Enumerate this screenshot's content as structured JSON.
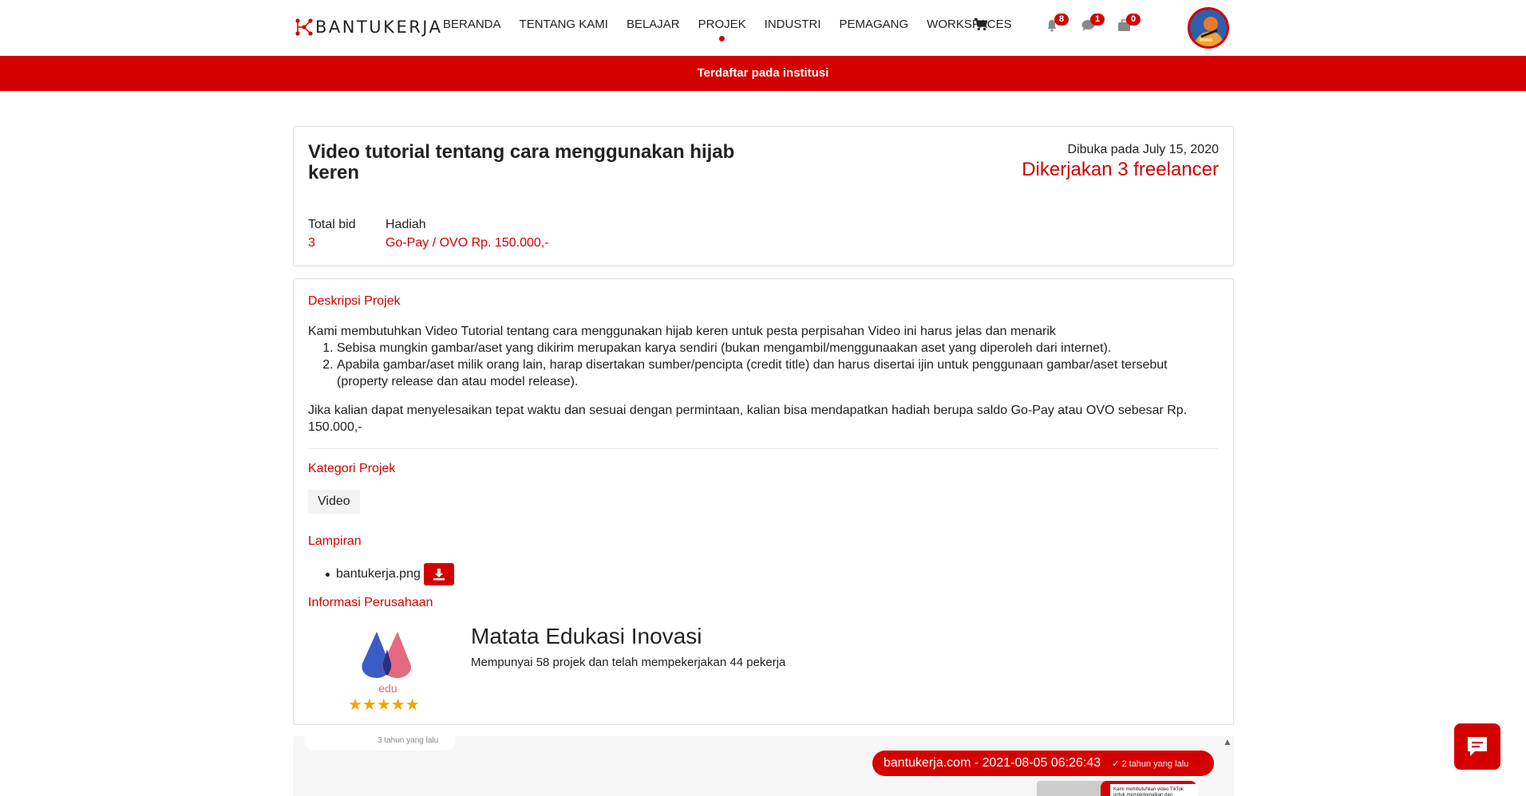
{
  "brand": {
    "name": "BANTUKERJA"
  },
  "nav": {
    "items": [
      {
        "label": "BERANDA",
        "active": false
      },
      {
        "label": "TENTANG KAMI",
        "active": false
      },
      {
        "label": "BELAJAR",
        "active": false
      },
      {
        "label": "PROJEK",
        "active": true
      },
      {
        "label": "INDUSTRI",
        "active": false
      },
      {
        "label": "PEMAGANG",
        "active": false
      },
      {
        "label": "WORKSPACES",
        "active": false
      }
    ],
    "icons": {
      "cart": "cart-icon",
      "bell": "bell-icon",
      "chat": "chat-icon",
      "briefcase": "briefcase-icon"
    },
    "badges": {
      "notifications": "8",
      "messages": "1",
      "jobs": "0"
    }
  },
  "banner": {
    "text": "Terdaftar pada institusi"
  },
  "project": {
    "title": "Video tutorial tentang cara menggunakan hijab keren",
    "opened": "Dibuka pada July 15, 2020",
    "workers": "Dikerjakan 3 freelancer",
    "total_bid_label": "Total bid",
    "total_bid_value": "3",
    "reward_label": "Hadiah",
    "reward_value": "Go-Pay / OVO Rp. 150.000,-"
  },
  "description": {
    "heading": "Deskripsi Projek",
    "intro": "Kami membutuhkan Video Tutorial tentang cara menggunakan hijab keren untuk pesta perpisahan Video ini harus jelas dan menarik",
    "items": [
      "Sebisa mungkin gambar/aset yang dikirim merupakan karya sendiri (bukan mengambil/menggunaakan aset yang diperoleh dari internet).",
      "Apabila gambar/aset milik orang lain, harap disertakan sumber/pencipta (credit title) dan harus disertai ijin untuk penggunaan gambar/aset tersebut (property release dan atau model release)."
    ],
    "closing": "Jika kalian dapat menyelesaikan tepat waktu dan sesuai dengan permintaan, kalian bisa mendapatkan hadiah berupa saldo Go-Pay atau OVO sebesar Rp. 150.000,-"
  },
  "category": {
    "heading": "Kategori Projek",
    "value": "Video"
  },
  "attachments": {
    "heading": "Lampiran",
    "file": "bantukerja.png",
    "download_icon": "download-icon"
  },
  "company": {
    "heading": "Informasi Perusahaan",
    "name": "Matata Edukasi Inovasi",
    "logo_text": "edu",
    "info": "Mempunyai 58 projek dan telah mempekerjakan 44 pekerja",
    "rating": 5,
    "stars": "★★★★★"
  },
  "chat_strip": {
    "ghost_time": "3 tahun yang lalu",
    "message": "bantukerja.com - 2021-08-05 06:26:43",
    "ago": "✓ 2 tahun yang lalu",
    "thumb_text": "Kami membutuhkan video TikTok untuk memperkenalkan dan mempromosikan Bantu"
  },
  "colors": {
    "accent": "#d40000",
    "star": "#f0a500"
  }
}
